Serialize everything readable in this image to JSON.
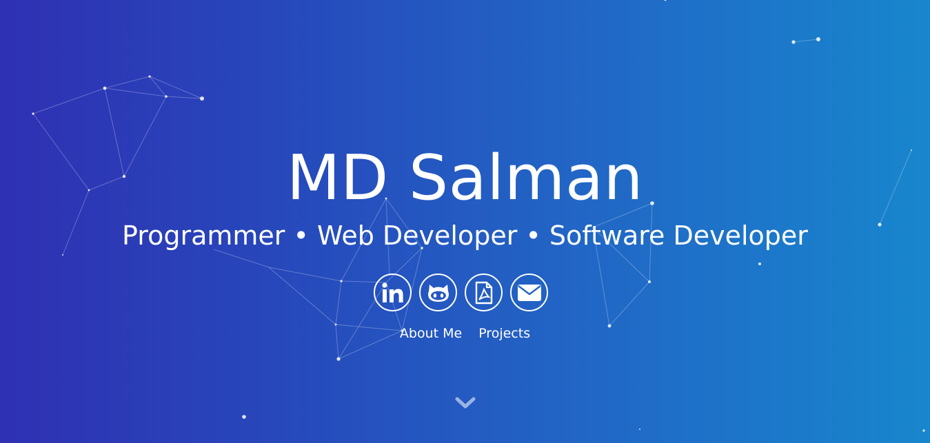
{
  "hero": {
    "name": "MD Salman",
    "tagline": "Programmer • Web Developer • Software Developer",
    "social": [
      {
        "label": "LinkedIn",
        "icon": "linkedin-icon"
      },
      {
        "label": "GitHub",
        "icon": "github-icon"
      },
      {
        "label": "Resume PDF",
        "icon": "pdf-icon"
      },
      {
        "label": "Email",
        "icon": "envelope-icon"
      }
    ],
    "links": {
      "about": "About Me",
      "projects": "Projects"
    },
    "scroll_icon": "chevron-down-icon"
  },
  "colors": {
    "gradient_start": "#2f30b3",
    "gradient_end": "#1886cd",
    "text": "#ffffff"
  }
}
